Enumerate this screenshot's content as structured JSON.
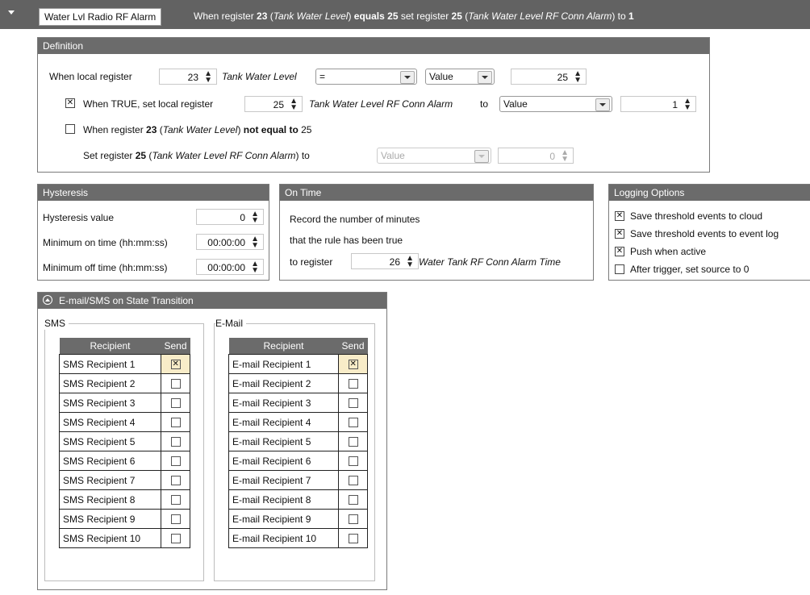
{
  "topbar": {
    "rule_name": "Water Lvl Radio RF Alarm",
    "summary": {
      "p1": "When register ",
      "reg1": "23",
      "p2": " (",
      "reg1_name": "Tank Water Level",
      "p3": ") ",
      "cond": "equals",
      "p4": " ",
      "value": "25",
      "p5": " set register ",
      "reg2": "25",
      "p6": " (",
      "reg2_name": "Tank Water Level RF Conn Alarm",
      "p7": ") to ",
      "target": "1"
    }
  },
  "definition": {
    "title": "Definition",
    "row1": {
      "label": "When local register",
      "register": "23",
      "register_name": "Tank Water Level",
      "operator": "=",
      "source_type": "Value",
      "value": "25"
    },
    "row2": {
      "checked": true,
      "label": "When TRUE, set local register",
      "register": "25",
      "register_name": "Tank Water Level RF Conn Alarm",
      "to_label": "to",
      "source_type": "Value",
      "value": "1"
    },
    "row3": {
      "checked": false,
      "p1": "When register ",
      "reg": "23",
      "p2": " (",
      "reg_name": "Tank Water Level",
      "p3": ") ",
      "cond": "not equal to",
      "p4": " 25"
    },
    "row4": {
      "p1": "Set register ",
      "reg": "25",
      "p2": " (",
      "reg_name": "Tank Water Level RF Conn Alarm",
      "p3": ") to",
      "source_type": "Value",
      "value": "0"
    }
  },
  "hysteresis": {
    "title": "Hysteresis",
    "value_label": "Hysteresis value",
    "value": "0",
    "min_on_label": "Minimum on time (hh:mm:ss)",
    "min_on": "00:00:00",
    "min_off_label": "Minimum off time (hh:mm:ss)",
    "min_off": "00:00:00"
  },
  "on_time": {
    "title": "On Time",
    "line1": "Record the number of minutes",
    "line2": "that the rule has been true",
    "line3": "to register",
    "register": "26",
    "register_name": "Water Tank RF Conn Alarm Time"
  },
  "logging": {
    "title": "Logging Options",
    "options": [
      {
        "label": "Save threshold events to cloud",
        "checked": true
      },
      {
        "label": "Save threshold events to event log",
        "checked": true
      },
      {
        "label": "Push when active",
        "checked": true
      },
      {
        "label": "After trigger, set source to 0",
        "checked": false
      }
    ]
  },
  "email_sms": {
    "title": "E-mail/SMS on State Transition",
    "sms": {
      "group_label": "SMS",
      "col_recipient": "Recipient",
      "col_send": "Send",
      "rows": [
        {
          "name": "SMS Recipient 1",
          "send": true
        },
        {
          "name": "SMS Recipient 2",
          "send": false
        },
        {
          "name": "SMS Recipient 3",
          "send": false
        },
        {
          "name": "SMS Recipient 4",
          "send": false
        },
        {
          "name": "SMS Recipient 5",
          "send": false
        },
        {
          "name": "SMS Recipient 6",
          "send": false
        },
        {
          "name": "SMS Recipient 7",
          "send": false
        },
        {
          "name": "SMS Recipient 8",
          "send": false
        },
        {
          "name": "SMS Recipient 9",
          "send": false
        },
        {
          "name": "SMS Recipient 10",
          "send": false
        }
      ]
    },
    "email": {
      "group_label": "E-Mail",
      "col_recipient": "Recipient",
      "col_send": "Send",
      "rows": [
        {
          "name": "E-mail Recipient 1",
          "send": true
        },
        {
          "name": "E-mail Recipient 2",
          "send": false
        },
        {
          "name": "E-mail Recipient 3",
          "send": false
        },
        {
          "name": "E-mail Recipient 4",
          "send": false
        },
        {
          "name": "E-mail Recipient 5",
          "send": false
        },
        {
          "name": "E-mail Recipient 6",
          "send": false
        },
        {
          "name": "E-mail Recipient 7",
          "send": false
        },
        {
          "name": "E-mail Recipient 8",
          "send": false
        },
        {
          "name": "E-mail Recipient 9",
          "send": false
        },
        {
          "name": "E-mail Recipient 10",
          "send": false
        }
      ]
    }
  }
}
